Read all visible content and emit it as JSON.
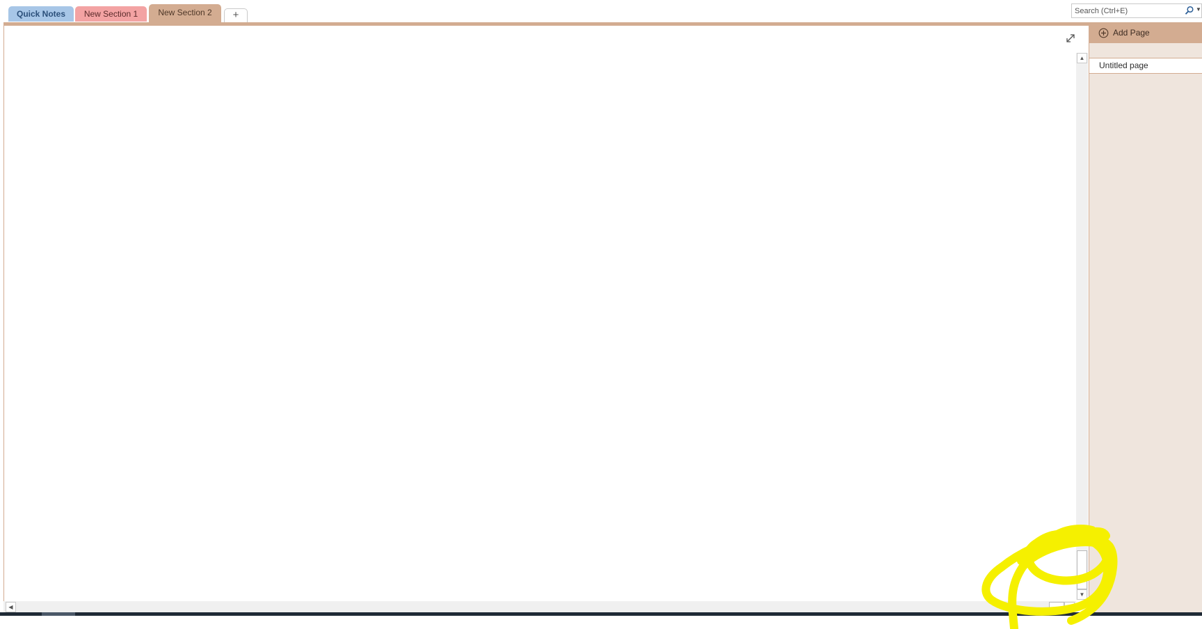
{
  "section_tabs": [
    {
      "label": "Quick Notes",
      "color": "#a7c6e7"
    },
    {
      "label": "New Section 1",
      "color": "#f3a3a3"
    },
    {
      "label": "New Section 2",
      "color": "#d3ac91",
      "selected": true
    }
  ],
  "add_section_label": "+",
  "search": {
    "placeholder": "Search (Ctrl+E)",
    "value": ""
  },
  "page_list": {
    "add_page_label": "Add Page",
    "pages": [
      {
        "title": "Untitled page"
      }
    ]
  },
  "colors": {
    "section_accent": "#d3ac91",
    "page_pane_bg": "#efe5dd",
    "highlighter": "#f5f000"
  },
  "icons": {
    "expand": "expand-icon",
    "search": "search-icon",
    "add_page": "plus-circle-icon",
    "scroll_up": "arrow-up-icon",
    "scroll_down": "arrow-down-icon",
    "scroll_left": "arrow-left-icon",
    "scroll_right": "arrow-right-icon"
  }
}
